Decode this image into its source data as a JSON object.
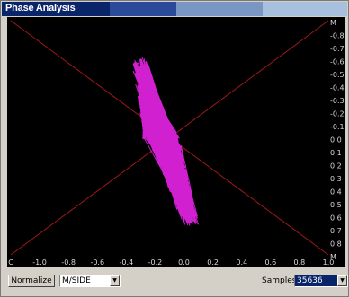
{
  "window": {
    "title": "Phase Analysis"
  },
  "colors": {
    "title_seg1": "#0a246a",
    "title_seg2": "#2c4a9a",
    "title_seg3": "#7a96c2",
    "title_seg4": "#a6c0de",
    "trace": "#d020d0",
    "guides": "#a01818",
    "ticks": "#d8d8d8"
  },
  "plot": {
    "y_labels": [
      "M",
      "-0.8",
      "-0.7",
      "-0.6",
      "-0.5",
      "-0.4",
      "-0.3",
      "-0.2",
      "-0.1",
      "0.0",
      "0.1",
      "0.2",
      "0.3",
      "0.4",
      "0.5",
      "0.6",
      "0.7",
      "0.8",
      "M"
    ],
    "x_labels": [
      "C",
      "-1.0",
      "-0.8",
      "-0.6",
      "-0.4",
      "-0.2",
      "0.0",
      "0.2",
      "0.4",
      "0.6",
      "0.8",
      "1.0"
    ]
  },
  "controls": {
    "normalize_label": "Normalize",
    "mode_value": "M/SIDE",
    "samples_label": "Samples",
    "samples_value": "35636",
    "dropdown_icon": "triangle-down-icon"
  }
}
